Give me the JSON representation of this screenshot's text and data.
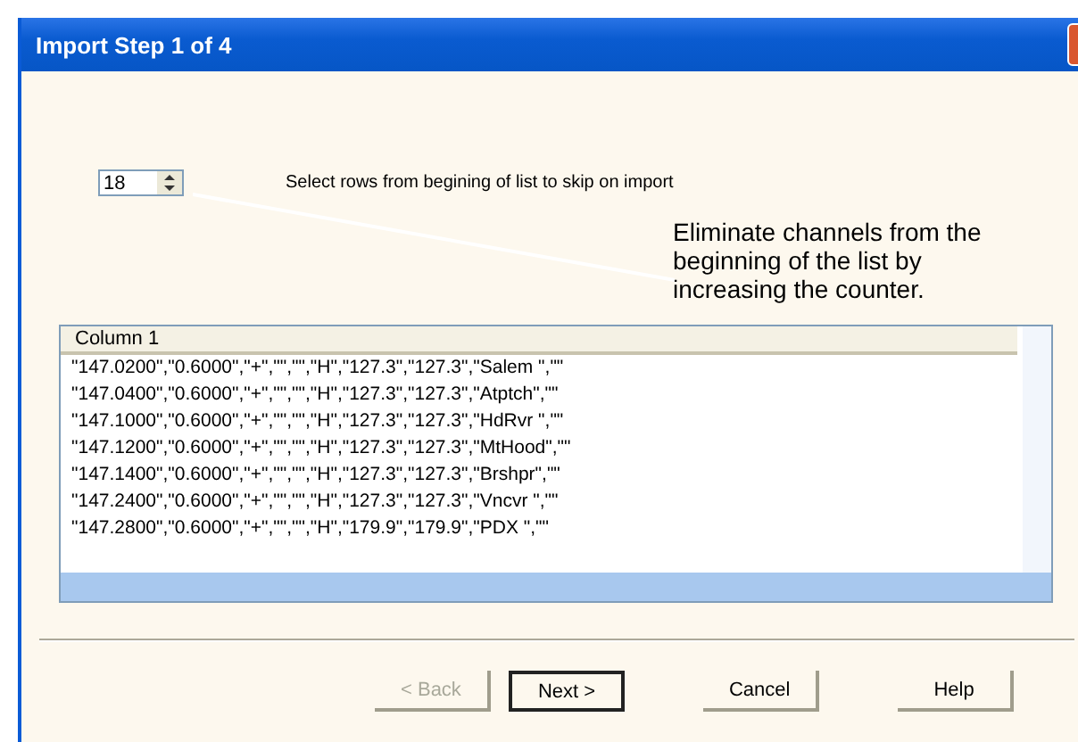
{
  "window": {
    "title": "Import Step 1 of 4"
  },
  "skip_rows": {
    "value": "18",
    "label": "Select rows from begining of list to skip on import"
  },
  "callout": "Eliminate channels from the beginning of the list by increasing the counter.",
  "list": {
    "columns": [
      "Column 1"
    ],
    "rows": [
      "\"147.0200\",\"0.6000\",\"+\",\"\",\"\",\"H\",\"127.3\",\"127.3\",\"Salem \",\"\"",
      "\"147.0400\",\"0.6000\",\"+\",\"\",\"\",\"H\",\"127.3\",\"127.3\",\"Atptch\",\"\"",
      "\"147.1000\",\"0.6000\",\"+\",\"\",\"\",\"H\",\"127.3\",\"127.3\",\"HdRvr \",\"\"",
      "\"147.1200\",\"0.6000\",\"+\",\"\",\"\",\"H\",\"127.3\",\"127.3\",\"MtHood\",\"\"",
      "\"147.1400\",\"0.6000\",\"+\",\"\",\"\",\"H\",\"127.3\",\"127.3\",\"Brshpr\",\"\"",
      "\"147.2400\",\"0.6000\",\"+\",\"\",\"\",\"H\",\"127.3\",\"127.3\",\"Vncvr \",\"\"",
      "\"147.2800\",\"0.6000\",\"+\",\"\",\"\",\"H\",\"179.9\",\"179.9\",\"PDX   \",\"\""
    ]
  },
  "buttons": [
    {
      "label": "< Back",
      "disabled": true,
      "default": false
    },
    {
      "label": "Next >",
      "disabled": false,
      "default": true
    },
    {
      "label": "Cancel",
      "disabled": false,
      "default": false
    },
    {
      "label": "Help",
      "disabled": false,
      "default": false
    }
  ]
}
